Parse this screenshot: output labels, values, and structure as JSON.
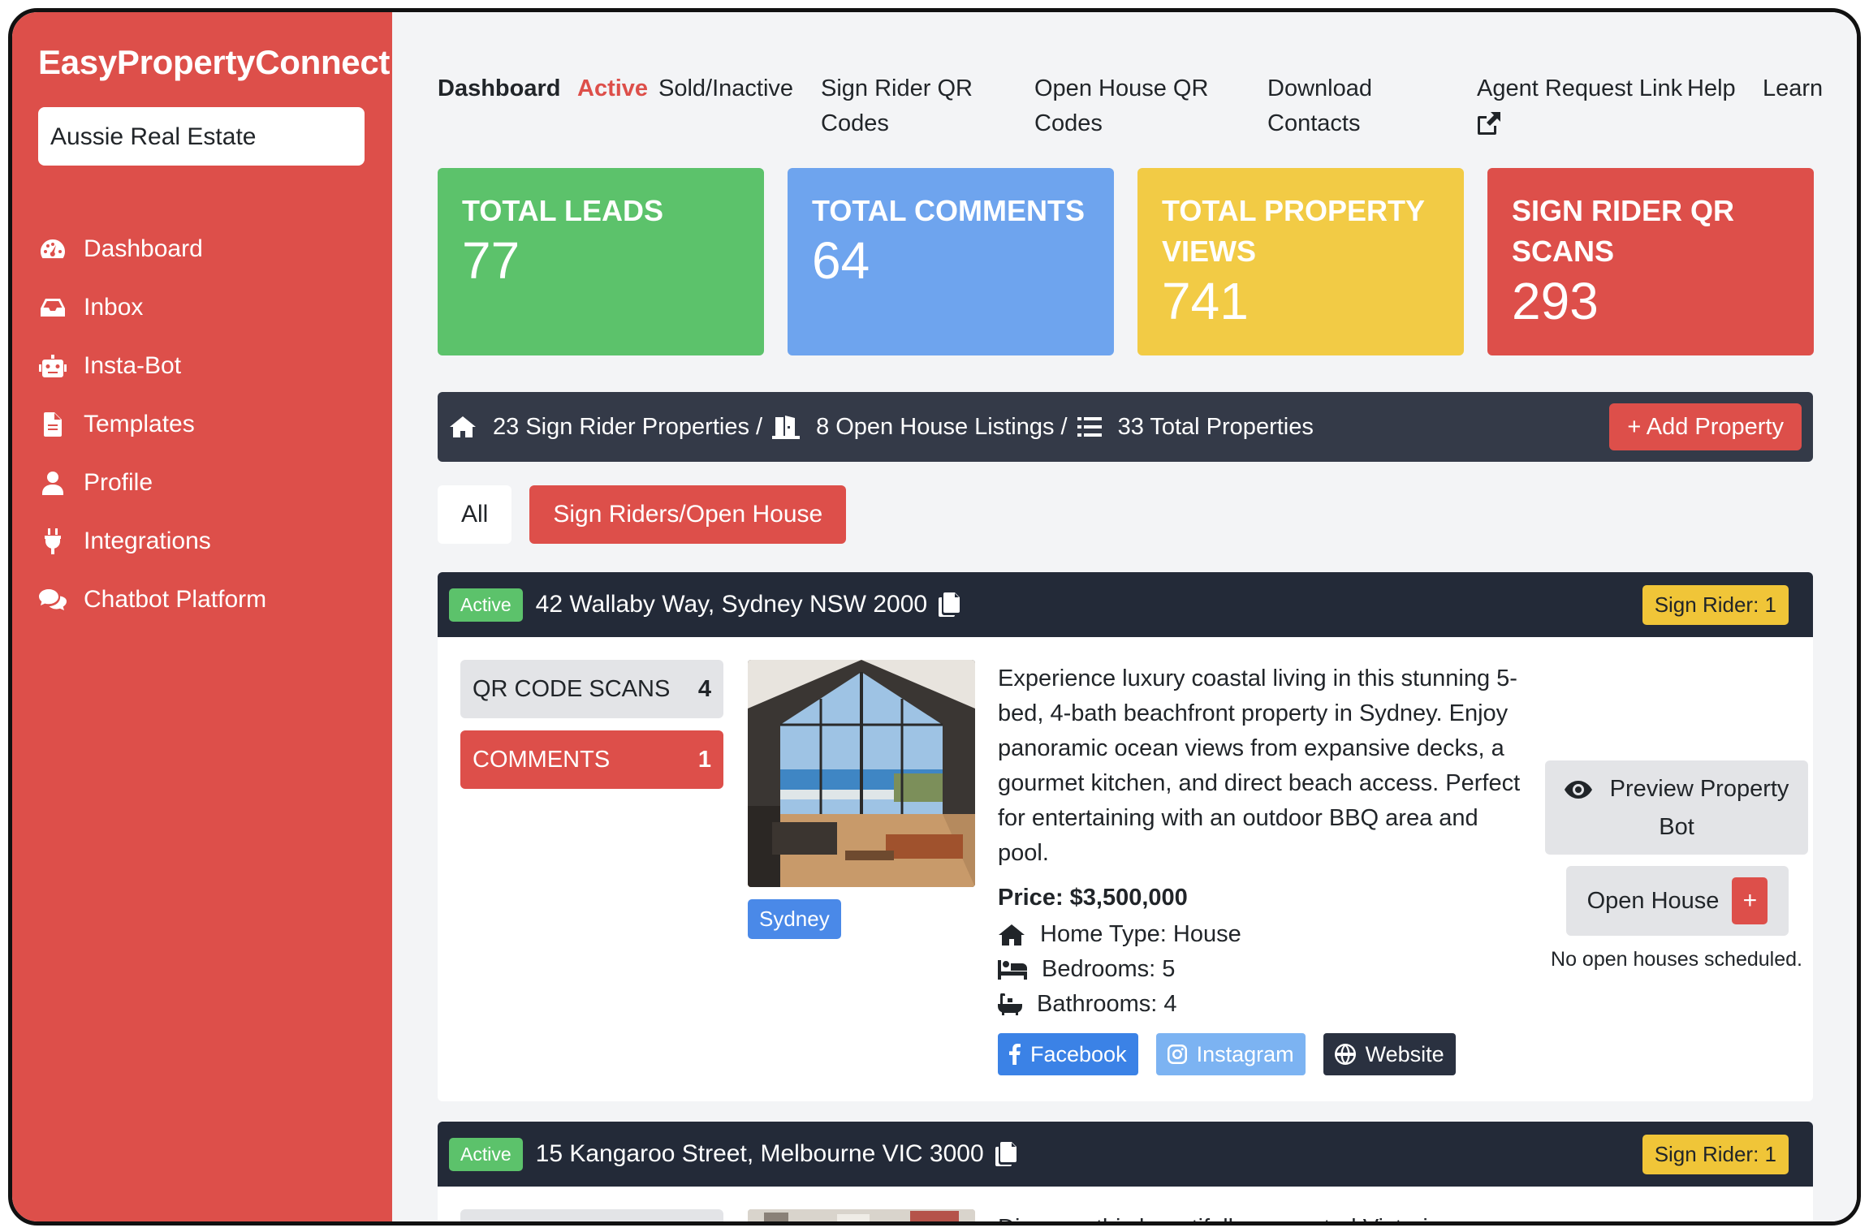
{
  "app": {
    "brand": "EasyPropertyConnect",
    "org_selector": "Aussie Real Estate"
  },
  "sidebar": {
    "items": [
      {
        "label": "Dashboard",
        "icon": "gauge-icon"
      },
      {
        "label": "Inbox",
        "icon": "inbox-icon"
      },
      {
        "label": "Insta-Bot",
        "icon": "robot-icon"
      },
      {
        "label": "Templates",
        "icon": "file-icon"
      },
      {
        "label": "Profile",
        "icon": "user-icon"
      },
      {
        "label": "Integrations",
        "icon": "plug-icon"
      },
      {
        "label": "Chatbot Platform",
        "icon": "comments-icon"
      }
    ]
  },
  "topnav": {
    "dashboard": "Dashboard",
    "active": "Active",
    "sold": "Sold/Inactive",
    "sign_rider_qr_1": "Sign Rider QR",
    "sign_rider_qr_2": "Codes",
    "open_house_qr_1": "Open House QR",
    "open_house_qr_2": "Codes",
    "download_1": "Download",
    "download_2": "Contacts",
    "agent_request": "Agent Request Link",
    "help": "Help",
    "learn": "Learn"
  },
  "stats": [
    {
      "label": "TOTAL LEADS",
      "value": "77",
      "color": "#5cc26b"
    },
    {
      "label": "TOTAL COMMENTS",
      "value": "64",
      "color": "#6ea4ee"
    },
    {
      "label": "TOTAL PROPERTY VIEWS",
      "value": "741",
      "color": "#f2cb45"
    },
    {
      "label": "SIGN RIDER QR SCANS",
      "value": "293",
      "color": "#dd4f4a"
    }
  ],
  "property_bar": {
    "sign_rider": "23 Sign Rider Properties /",
    "open_house": "8 Open House Listings /",
    "total": "33 Total Properties",
    "add_button": "+ Add Property"
  },
  "filters": {
    "all": "All",
    "sign_riders": "Sign Riders/Open House"
  },
  "listings": [
    {
      "status": "Active",
      "address": "42 Wallaby Way, Sydney NSW 2000",
      "sign_rider": "Sign Rider: 1",
      "qr_scans_label": "QR CODE SCANS",
      "qr_scans": "4",
      "comments_label": "COMMENTS",
      "comments": "1",
      "city": "Sydney",
      "description_lines": [
        "Experience luxury coastal living in this stunning 5-",
        "bed, 4-bath beachfront property in Sydney. Enjoy",
        "panoramic ocean views from expansive decks, a",
        "gourmet kitchen, and direct beach access. Perfect",
        "for entertaining with an outdoor BBQ area and",
        "pool."
      ],
      "price": "Price: $3,500,000",
      "home_type": "Home Type: House",
      "bedrooms": "Bedrooms: 5",
      "bathrooms": "Bathrooms: 4",
      "facebook": "Facebook",
      "instagram": "Instagram",
      "website": "Website",
      "preview_1": "Preview Property",
      "preview_2": "Bot",
      "open_house": "Open House",
      "plus": "+",
      "no_open_houses": "No open houses scheduled."
    },
    {
      "status": "Active",
      "address": "15 Kangaroo Street, Melbourne VIC 3000",
      "sign_rider": "Sign Rider: 1",
      "description_partial": "Discover this beautifully renovated Victorian"
    }
  ]
}
